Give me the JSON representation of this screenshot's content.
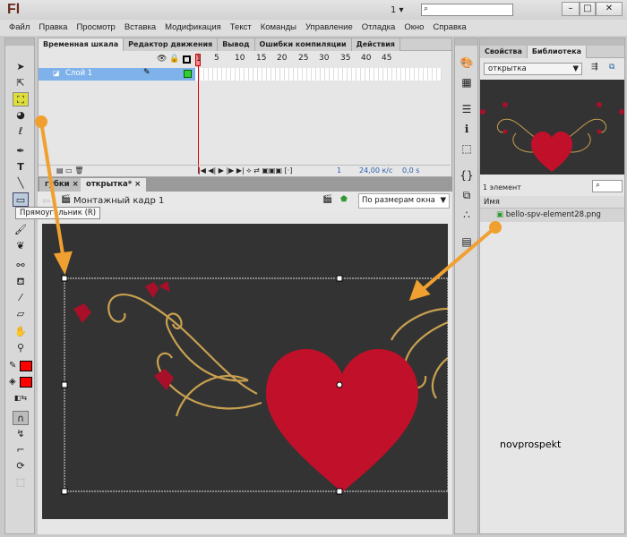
{
  "app": {
    "logo": "Fl",
    "workspace": "1 ▾",
    "search_placeholder": ""
  },
  "window": {
    "minimize": "–",
    "maximize": "□",
    "close": "✕"
  },
  "menu": [
    "Файл",
    "Правка",
    "Просмотр",
    "Вставка",
    "Модификация",
    "Текст",
    "Команды",
    "Управление",
    "Отладка",
    "Окно",
    "Справка"
  ],
  "timeline": {
    "tabs": [
      "Временная шкала",
      "Редактор движения",
      "Вывод",
      "Ошибки компиляции",
      "Действия"
    ],
    "frame_numbers": [
      "1",
      "5",
      "10",
      "15",
      "20",
      "25",
      "30",
      "35",
      "40",
      "45"
    ],
    "layer": "Слой 1",
    "current_frame": "1",
    "fps": "24,00 к/с",
    "time": "0,0 s"
  },
  "docs": {
    "tabs": [
      "губки",
      "открытка*"
    ]
  },
  "editbar": {
    "scene": "Монтажный кадр 1",
    "zoom": "По размерам окна"
  },
  "tooltip": "Прямоугольник (R)",
  "watermark": "novprospekt",
  "library": {
    "tabs": [
      "Свойства",
      "Библиотека"
    ],
    "document": "открытка",
    "count": "1 элемент",
    "column": "Имя",
    "items": [
      "bello-spv-element28.png"
    ]
  },
  "colors": {
    "stroke": "#ff0000",
    "fill": "#ff0000",
    "arrow": "#f0a030",
    "heart": "#c0102a",
    "gold": "#c8a050"
  }
}
